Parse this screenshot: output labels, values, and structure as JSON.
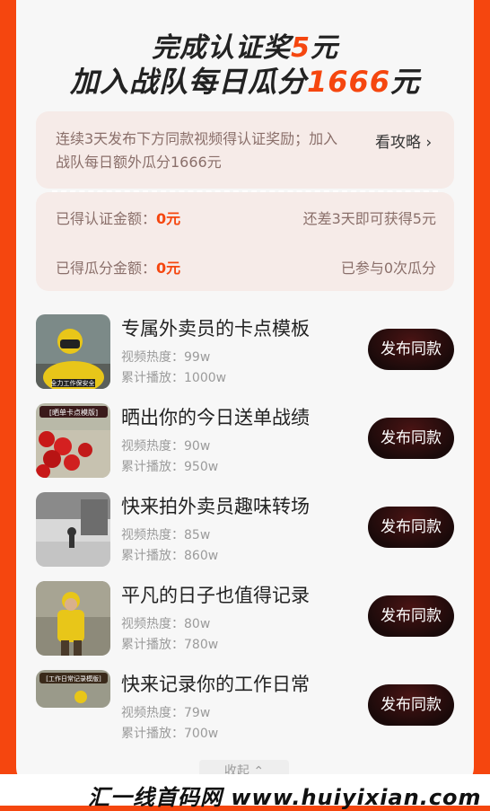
{
  "header": {
    "line1_prefix": "完成认证奖",
    "line1_amount": "5",
    "line1_suffix": "元",
    "line2_prefix": "加入战队每日瓜分",
    "line2_amount": "1666",
    "line2_suffix": "元"
  },
  "intro": {
    "description": "连续3天发布下方同款视频得认证奖励；加入战队每日额外瓜分1666元",
    "guide_link": "看攻略 ›"
  },
  "stats": {
    "cert_label": "已得认证金额：",
    "cert_value": "0元",
    "cert_hint": "还差3天即可获得5元",
    "share_label": "已得瓜分金额：",
    "share_value": "0元",
    "share_hint": "已参与0次瓜分"
  },
  "videos": [
    {
      "title": "专属外卖员的卡点模板",
      "heat": "视频热度：99w",
      "plays": "累计播放：1000w",
      "button": "发布同款"
    },
    {
      "title": "晒出你的今日送单战绩",
      "heat": "视频热度：90w",
      "plays": "累计播放：950w",
      "button": "发布同款"
    },
    {
      "title": "快来拍外卖员趣味转场",
      "heat": "视频热度：85w",
      "plays": "累计播放：860w",
      "button": "发布同款"
    },
    {
      "title": "平凡的日子也值得记录",
      "heat": "视频热度：80w",
      "plays": "累计播放：780w",
      "button": "发布同款"
    },
    {
      "title": "快来记录你的工作日常",
      "heat": "视频热度：79w",
      "plays": "累计播放：700w",
      "button": "发布同款"
    }
  ],
  "thumb_texts": [
    "全力工作保安全",
    "[晒单卡点模版]",
    "[工作日常记录模版]"
  ],
  "collapse_label": "收起 ⌃",
  "watermark": "汇一线首码网 www.huiyixian.com",
  "colors": {
    "accent": "#f5460f",
    "button_bg": "#2a0f0f"
  }
}
